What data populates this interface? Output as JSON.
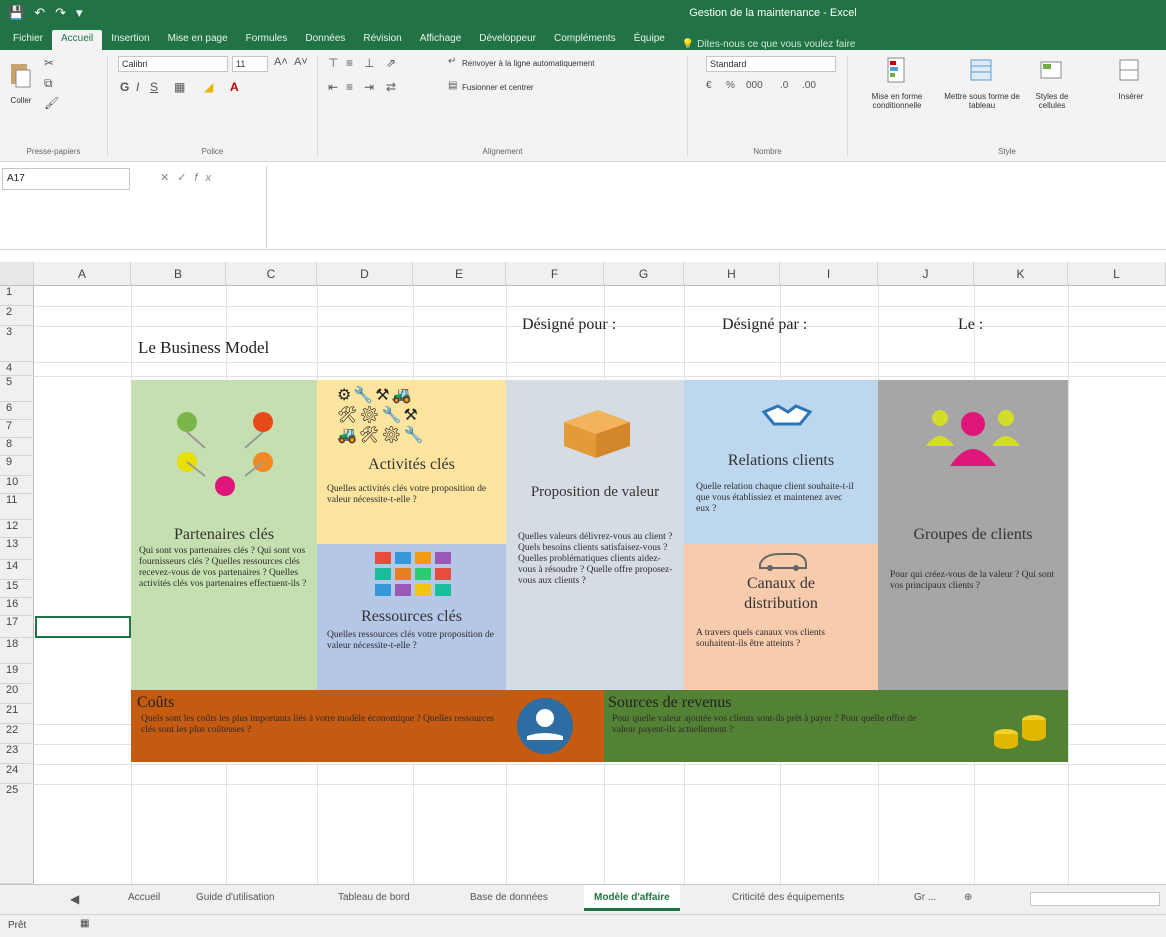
{
  "window": {
    "title": "Gestion de la maintenance - Excel"
  },
  "ribbon_tabs": [
    "Fichier",
    "Accueil",
    "Insertion",
    "Mise en page",
    "Formules",
    "Données",
    "Révision",
    "Affichage",
    "Développeur",
    "Compléments",
    "Équipe"
  ],
  "tell_me": "Dites-nous ce que vous voulez faire",
  "ribbon": {
    "paste": "Coller",
    "font_name": "Calibri",
    "font_size": "11",
    "wrap_text": "Renvoyer à la ligne automatiquement",
    "merge_center": "Fusionner et centrer",
    "number_format": "Standard",
    "conditional_format": "Mise en forme conditionnelle",
    "format_table": "Mettre sous forme de tableau",
    "cell_styles": "Styles de cellules",
    "insert": "Insérer",
    "groups": {
      "clipboard": "Presse-papiers",
      "font": "Police",
      "alignment": "Alignement",
      "number": "Nombre",
      "styles": "Style"
    }
  },
  "formula_bar": {
    "name_box": "A17",
    "fx": "fx",
    "content": ""
  },
  "columns": [
    "A",
    "B",
    "C",
    "D",
    "E",
    "F",
    "G",
    "H",
    "I",
    "J",
    "K",
    "L"
  ],
  "rows": [
    "1",
    "2",
    "3",
    "4",
    "5",
    "6",
    "7",
    "8",
    "9",
    "10",
    "11",
    "12",
    "13",
    "14",
    "15",
    "16",
    "17",
    "18",
    "19",
    "20",
    "21",
    "22",
    "23",
    "24",
    "25"
  ],
  "canvas": {
    "title": "Le Business Model",
    "designed_for": "Désigné pour :",
    "designed_by": "Désigné par :",
    "date": "Le :",
    "partners": {
      "title": "Partenaires clés",
      "text": "Qui sont vos partenaires clés ? Qui sont vos fournisseurs clés ? Quelles ressources clés recevez-vous de vos partenaires ? Quelles activités clés vos partenaires effectuent-ils ?"
    },
    "activities": {
      "title": "Activités clés",
      "text": "Quelles activités clés votre proposition de valeur nécessite-t-elle ?"
    },
    "resources": {
      "title": "Ressources clés",
      "text": "Quelles ressources clés votre proposition de valeur nécessite-t-elle ?"
    },
    "value": {
      "title": "Proposition de valeur",
      "text": "Quelles valeurs délivrez-vous au client ? Quels besoins clients satisfaisez-vous ? Quelles problématiques clients aidez-vous à résoudre ? Quelle offre proposez-vous aux clients ?"
    },
    "relations": {
      "title": "Relations clients",
      "text": "Quelle relation chaque client souhaite-t-il que vous établissiez et maintenez avec eux ?"
    },
    "channels": {
      "title": "Canaux de distribution",
      "text": "A travers quels canaux vos clients souhaitent-ils être atteints ?"
    },
    "segments": {
      "title": "Groupes de clients",
      "text": "Pour qui créez-vous de la valeur ? Qui sont vos principaux clients ?"
    },
    "costs": {
      "title": "Coûts",
      "text": "Quels sont les coûts les plus importants liés à votre modèle économique ? Quelles ressources clés sont les plus coûteuses ?"
    },
    "revenue": {
      "title": "Sources de revenus",
      "text": "Pour quelle valeur ajoutée vos clients sont-ils prêt à payer ? Pour quelle offre de valeur payent-ils actuellement ?"
    }
  },
  "sheet_tabs": [
    "Accueil",
    "Guide d'utilisation",
    "Tableau de bord",
    "Base de données",
    "Modèle d'affaire",
    "Criticité des équipements",
    "Gr ..."
  ],
  "active_sheet": "Modèle d'affaire",
  "status": "Prêt",
  "colors": {
    "excel_green": "#217346",
    "partners": "#c6dfb1",
    "activities": "#fde5a0",
    "resources": "#b4c7e7",
    "value": "#d6dce4",
    "relations": "#bdd7ee",
    "channels": "#f8cbad",
    "segments": "#a6a6a6",
    "costs": "#c55a11",
    "revenue": "#548235"
  }
}
